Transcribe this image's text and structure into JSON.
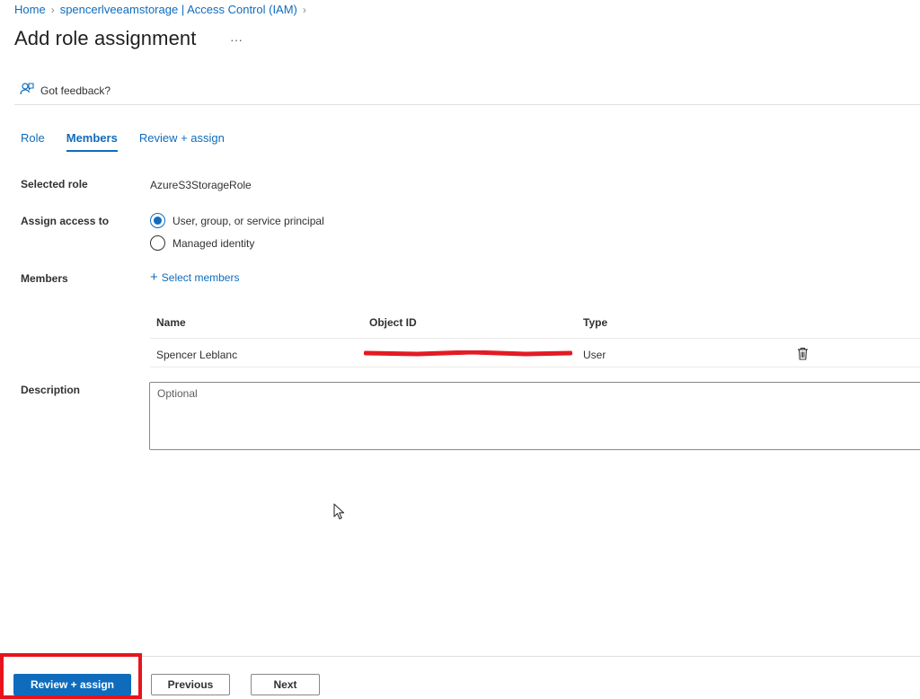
{
  "breadcrumb": {
    "items": [
      "Home",
      "spencerlveeamstorage | Access Control (IAM)"
    ]
  },
  "page": {
    "title": "Add role assignment",
    "more": "···"
  },
  "feedback": {
    "label": "Got feedback?"
  },
  "tabs": [
    {
      "label": "Role",
      "active": false
    },
    {
      "label": "Members",
      "active": true
    },
    {
      "label": "Review + assign",
      "active": false
    }
  ],
  "form": {
    "selected_role_label": "Selected role",
    "selected_role_value": "AzureS3StorageRole",
    "assign_access_label": "Assign access to",
    "assign_options": [
      {
        "label": "User, group, or service principal",
        "selected": true
      },
      {
        "label": "Managed identity",
        "selected": false
      }
    ],
    "members_label": "Members",
    "select_members": "Select members",
    "description_label": "Description",
    "description_placeholder": "Optional"
  },
  "members_table": {
    "headers": [
      "Name",
      "Object ID",
      "Type"
    ],
    "rows": [
      {
        "name": "Spencer Leblanc",
        "object_id": "",
        "type": "User"
      }
    ]
  },
  "footer": {
    "review_assign": "Review + assign",
    "previous": "Previous",
    "next": "Next"
  },
  "colors": {
    "accent": "#0f6cbd",
    "highlight": "#e8141c",
    "redaction": "#e31b23"
  },
  "icons": [
    "chevron-right-icon",
    "more-icon",
    "feedback-icon",
    "plus-icon",
    "delete-icon",
    "cursor-icon"
  ]
}
